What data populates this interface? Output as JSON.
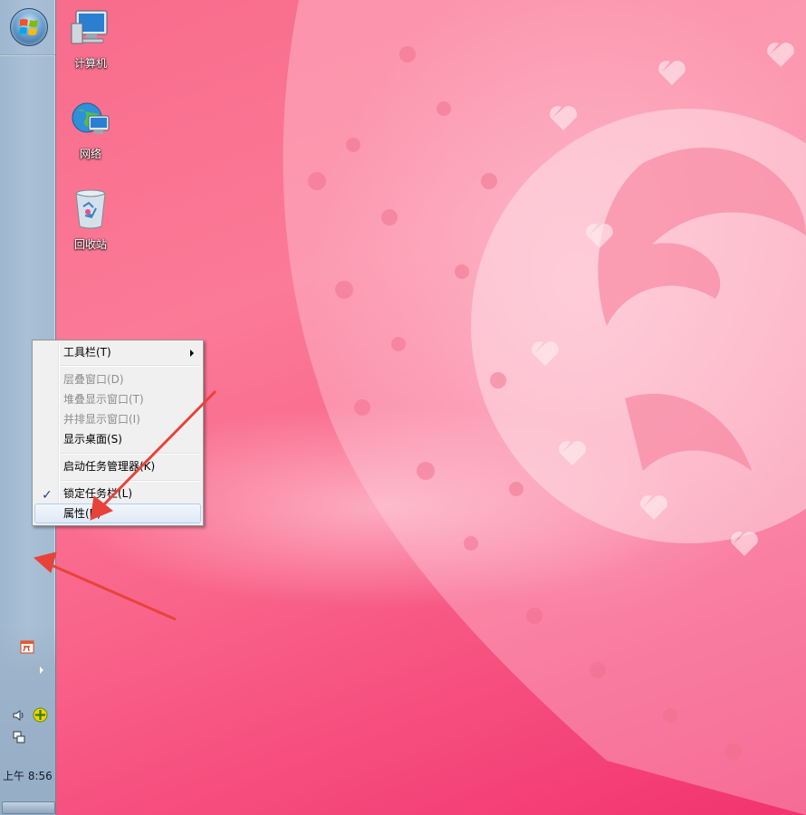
{
  "desktop": {
    "icons": [
      {
        "label": "计算机",
        "icon": "computer-icon"
      },
      {
        "label": "网络",
        "icon": "network-icon"
      },
      {
        "label": "回收站",
        "icon": "recycle-bin-icon"
      }
    ]
  },
  "taskbar": {
    "start_icon": "windows-start-orb-icon",
    "tray_icons": [
      "calendar-icon",
      "expand-tray-arrow-icon",
      "volume-icon",
      "network-status-icon",
      "network-connection-icon"
    ],
    "clock": "上午 8:56"
  },
  "context_menu": {
    "items": [
      {
        "label": "工具栏(T)",
        "enabled": true,
        "submenu": true
      },
      {
        "label": "层叠窗口(D)",
        "enabled": false
      },
      {
        "label": "堆叠显示窗口(T)",
        "enabled": false
      },
      {
        "label": "并排显示窗口(I)",
        "enabled": false
      },
      {
        "label": "显示桌面(S)",
        "enabled": true
      },
      {
        "label": "启动任务管理器(K)",
        "enabled": true
      },
      {
        "label": "锁定任务栏(L)",
        "enabled": true,
        "checked": true
      },
      {
        "label": "属性(R)",
        "enabled": true,
        "highlighted": true
      }
    ]
  },
  "colors": {
    "wallpaper": "#f9648a",
    "taskbar": "#a9c0d6",
    "annotation_arrow": "#e8433a"
  }
}
